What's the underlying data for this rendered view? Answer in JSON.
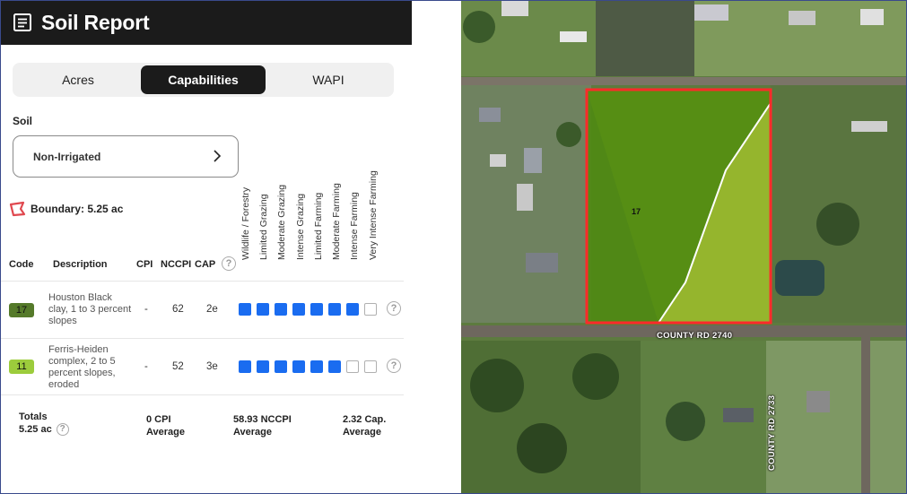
{
  "header": {
    "title": "Soil Report",
    "icon": "report-document-icon"
  },
  "tabs": [
    {
      "label": "Acres",
      "active": false
    },
    {
      "label": "Capabilities",
      "active": true
    },
    {
      "label": "WAPI",
      "active": false
    }
  ],
  "soil": {
    "label": "Soil",
    "selected": "Non-Irrigated"
  },
  "boundary": {
    "label": "Boundary: 5.25 ac",
    "color": "#e0484f"
  },
  "columns": {
    "code": "Code",
    "description": "Description",
    "cpi": "CPI",
    "nccpi": "NCCPI",
    "cap": "CAP",
    "capabilities": [
      "Wildlife / Forestry",
      "Limited Grazing",
      "Moderate Grazing",
      "Intense Grazing",
      "Limited Farming",
      "Moderate Farming",
      "Intense Farming",
      "Very Intense Farming"
    ]
  },
  "rows": [
    {
      "code": "17",
      "code_color": "#557a2a",
      "description": "Houston Black clay, 1 to 3 percent slopes",
      "cpi": "-",
      "nccpi": "62",
      "cap": "2e",
      "capability_level": 7
    },
    {
      "code": "11",
      "code_color": "#9ccc3c",
      "description": "Ferris-Heiden complex, 2 to 5 percent slopes, eroded",
      "cpi": "-",
      "nccpi": "52",
      "cap": "3e",
      "capability_level": 6
    }
  ],
  "totals": {
    "label": "Totals",
    "acres": "5.25 ac",
    "cpi_value": "0 CPI",
    "cpi_sub": "Average",
    "nccpi_value": "58.93 NCCPI",
    "nccpi_sub": "Average",
    "cap_value": "2.32 Cap.",
    "cap_sub": "Average"
  },
  "map": {
    "parcel_label": "17",
    "road_main": "COUNTY RD 2740",
    "road_side": "COUNTY RD 2733",
    "parcel_outline_color": "#ff2a2a",
    "zone_17_color": "#4f8a12",
    "zone_11_color": "#9fbf2a"
  }
}
